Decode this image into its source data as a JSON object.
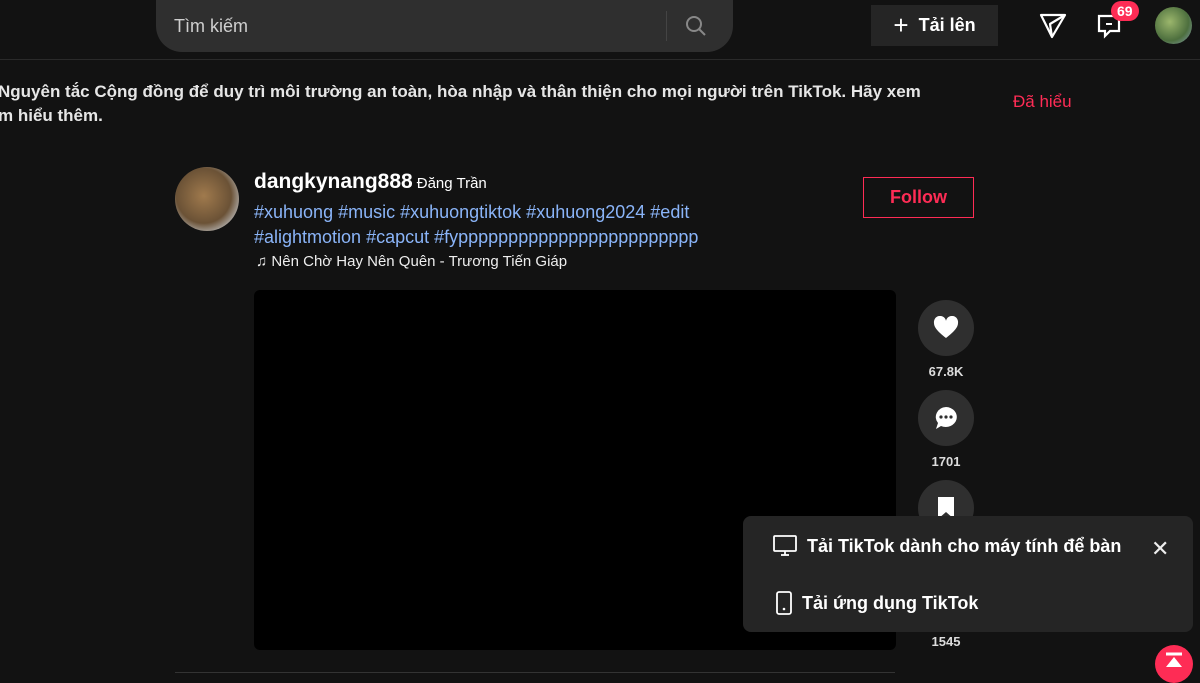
{
  "header": {
    "search_placeholder": "Tìm kiếm",
    "upload_label": "Tải lên",
    "inbox_badge": "69"
  },
  "notice": {
    "text": "Nguyên tắc Cộng đồng để duy trì môi trường an toàn, hòa nhập và thân thiện cho mọi người trên TikTok. Hãy xem",
    "text2": "m hiểu thêm.",
    "dismiss": "Đã hiểu"
  },
  "post": {
    "username": "dangkynang888",
    "display_name": "Đăng Trần",
    "hashtags": "#xuhuong #music #xuhuongtiktok #xuhuong2024 #edit #alightmotion #capcut #fypppppppppppppppppppppppp",
    "music": "Nên Chờ Hay Nên Quên - Trương Tiến Giáp",
    "follow_label": "Follow",
    "likes": "67.8K",
    "comments": "1701",
    "shares": "1545"
  },
  "popup": {
    "desktop_label": "Tải TikTok dành cho máy tính để bàn",
    "app_label": "Tải ứng dụng TikTok"
  },
  "colors": {
    "accent": "#fe2c55",
    "hashtag": "#8ab4f8",
    "background": "#121212"
  }
}
